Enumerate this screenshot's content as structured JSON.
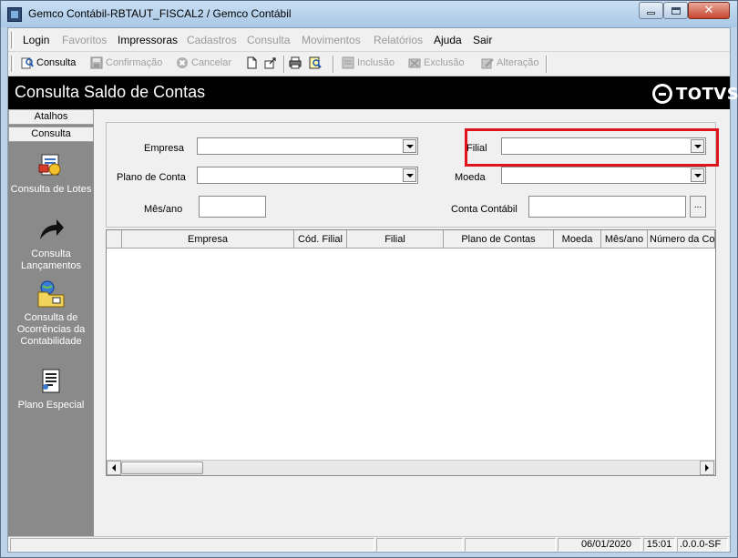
{
  "window": {
    "title": "Gemco Contábil-RBTAUT_FISCAL2 / Gemco Contábil"
  },
  "menu": [
    {
      "label": "Login",
      "enabled": true
    },
    {
      "label": "Favoritos",
      "enabled": false
    },
    {
      "label": "Impressoras",
      "enabled": true
    },
    {
      "label": "Cadastros",
      "enabled": false
    },
    {
      "label": "Consulta",
      "enabled": false
    },
    {
      "label": "Movimentos",
      "enabled": false
    },
    {
      "label": "Relatórios",
      "enabled": false
    },
    {
      "label": "Ajuda",
      "enabled": true
    },
    {
      "label": "Sair",
      "enabled": true
    }
  ],
  "toolbar": {
    "consulta": "Consulta",
    "confirmacao": "Confirmação",
    "cancelar": "Cancelar",
    "inclusao": "Inclusão",
    "exclusao": "Exclusão",
    "alteracao": "Alteração"
  },
  "header": {
    "title": "Consulta Saldo de Contas",
    "brand": "TOTVS"
  },
  "sidebar": {
    "tabs": [
      "Atalhos",
      "Consulta"
    ],
    "items": [
      {
        "label": "Consulta de Lotes",
        "icon": "lotes-icon"
      },
      {
        "label": "Consulta Lançamentos",
        "icon": "arrow-icon"
      },
      {
        "label": "Consulta de Ocorrências da Contabilidade",
        "icon": "folder-globe-icon"
      },
      {
        "label": "Plano Especial",
        "icon": "document-icon"
      }
    ]
  },
  "filters": {
    "empresa_label": "Empresa",
    "empresa_value": "",
    "filial_label": "Filial",
    "filial_value": "",
    "plano_label": "Plano de Conta",
    "plano_value": "",
    "moeda_label": "Moeda",
    "moeda_value": "",
    "mesano_label": "Mês/ano",
    "mesano_value": "",
    "conta_label": "Conta Contábil",
    "conta_value": "",
    "lookup": "..."
  },
  "grid": {
    "columns": [
      "Empresa",
      "Cód. Filial",
      "Filial",
      "Plano de Contas",
      "Moeda",
      "Mês/ano",
      "Número da Co"
    ]
  },
  "status": {
    "date": "06/01/2020",
    "time": "15:01",
    "version": ".0.0.0-SF"
  },
  "colors": {
    "header_bg": "#000000",
    "highlight": "#e0151b",
    "sidebar_bg": "#8a8a8a"
  }
}
